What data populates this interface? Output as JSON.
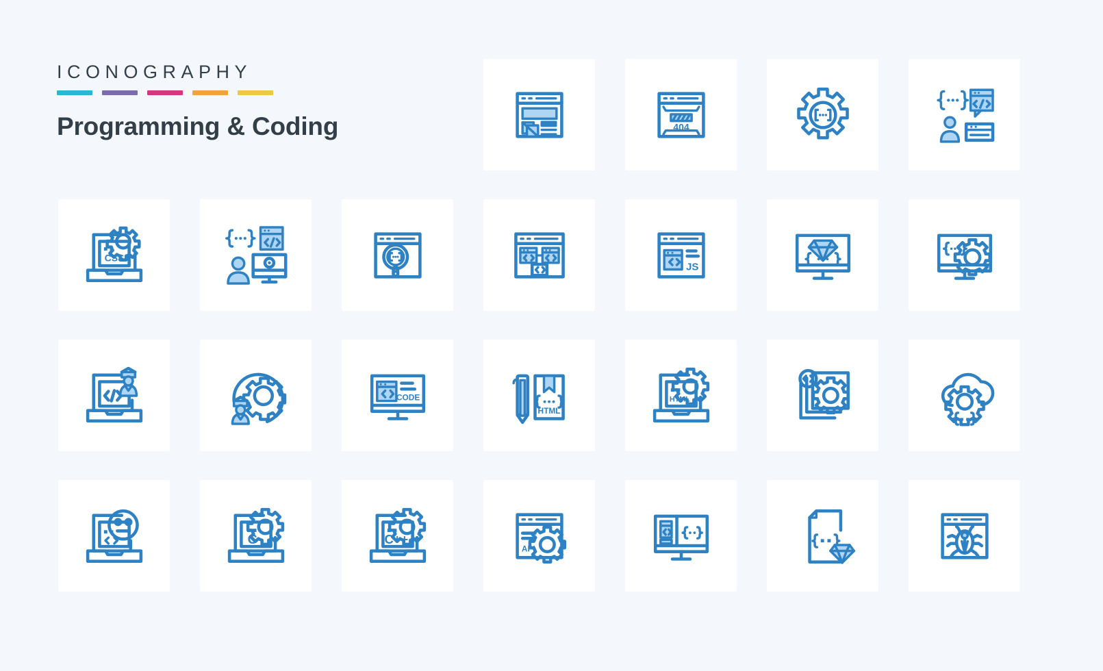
{
  "header": {
    "eyebrow": "ICONOGRAPHY",
    "title": "Programming & Coding",
    "swatches": [
      {
        "name": "swatch-cyan",
        "color": "#27b9d4"
      },
      {
        "name": "swatch-purple",
        "color": "#7b6bb0"
      },
      {
        "name": "swatch-pink",
        "color": "#d6357f"
      },
      {
        "name": "swatch-orange",
        "color": "#f0a23c"
      },
      {
        "name": "swatch-yellow",
        "color": "#efc githubs"
      }
    ]
  },
  "palette": {
    "page_background": "#f4f7fb",
    "tile_background": "#ffffff",
    "icon_stroke": "#2e82c4",
    "icon_fill_light": "#aed6f4",
    "text_dark": "#333f48"
  },
  "grid": {
    "columns": 7,
    "rows": 4,
    "icons": [
      {
        "slot": 1,
        "name": "empty-slot",
        "label": ""
      },
      {
        "slot": 2,
        "name": "empty-slot",
        "label": ""
      },
      {
        "slot": 3,
        "name": "empty-slot",
        "label": ""
      },
      {
        "slot": 4,
        "name": "web-layout-design-icon",
        "label": ""
      },
      {
        "slot": 5,
        "name": "error-404-browser-icon",
        "label": "404"
      },
      {
        "slot": 6,
        "name": "gear-code-settings-icon",
        "label": ""
      },
      {
        "slot": 7,
        "name": "developer-chat-code-icon",
        "label": ""
      },
      {
        "slot": 8,
        "name": "css-laptop-gear-icon",
        "label": "CSS"
      },
      {
        "slot": 9,
        "name": "developer-monitor-code-icon",
        "label": ""
      },
      {
        "slot": 10,
        "name": "browser-code-search-icon",
        "label": ""
      },
      {
        "slot": 11,
        "name": "browser-code-modules-icon",
        "label": ""
      },
      {
        "slot": 12,
        "name": "javascript-browser-icon",
        "label": "JS"
      },
      {
        "slot": 13,
        "name": "monitor-diamond-code-icon",
        "label": ""
      },
      {
        "slot": 14,
        "name": "monitor-code-gear-icon",
        "label": ""
      },
      {
        "slot": 15,
        "name": "laptop-code-developer-icon",
        "label": ""
      },
      {
        "slot": 16,
        "name": "developer-gear-cycle-icon",
        "label": ""
      },
      {
        "slot": 17,
        "name": "monitor-code-label-icon",
        "label": "CODE"
      },
      {
        "slot": 18,
        "name": "html-document-pencil-icon",
        "label": "HTML"
      },
      {
        "slot": 19,
        "name": "html-laptop-gear-icon",
        "label": "HTML"
      },
      {
        "slot": 20,
        "name": "code-files-gear-icon",
        "label": ""
      },
      {
        "slot": 21,
        "name": "cloud-gear-code-icon",
        "label": ""
      },
      {
        "slot": 22,
        "name": "laptop-code-emoji-icon",
        "label": ""
      },
      {
        "slot": 23,
        "name": "c-language-laptop-gear-icon",
        "label": "C"
      },
      {
        "slot": 24,
        "name": "cpp-language-laptop-gear-icon",
        "label": "C++"
      },
      {
        "slot": 25,
        "name": "api-browser-gear-icon",
        "label": "API"
      },
      {
        "slot": 26,
        "name": "monitor-split-code-icon",
        "label": ""
      },
      {
        "slot": 27,
        "name": "file-code-diamond-icon",
        "label": ""
      },
      {
        "slot": 28,
        "name": "browser-bug-debug-icon",
        "label": ""
      }
    ],
    "icon_text_labels": {
      "error_404": "404",
      "css": "CSS",
      "js": "JS",
      "code": "CODE",
      "html_doc": "HTML",
      "html_laptop": "HTML",
      "c_lang": "C",
      "cpp_lang": "C++",
      "api": "API"
    }
  }
}
